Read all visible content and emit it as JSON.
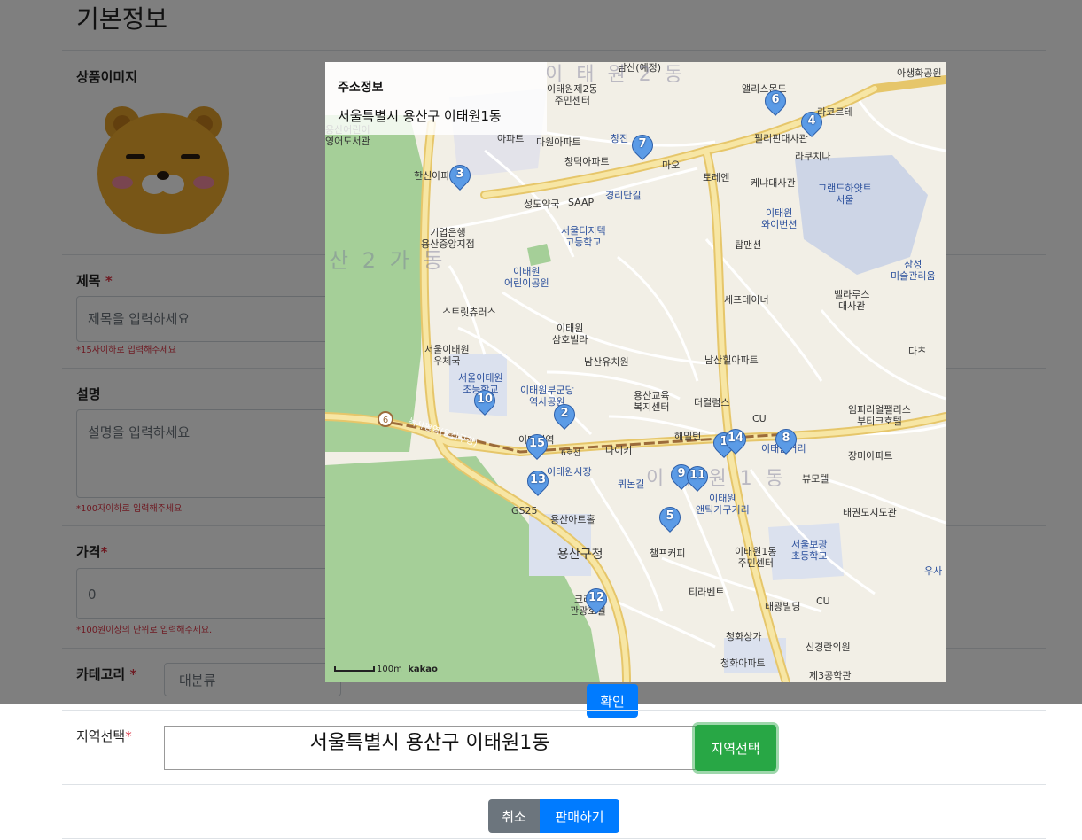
{
  "form": {
    "section_title": "기본정보",
    "image_label": "상품이미지",
    "title_label": "제목",
    "required_mark": "*",
    "title_placeholder": "제목을 입력하세요",
    "title_hint": "*15자이하로 입력해주세요",
    "desc_label": "설명",
    "desc_placeholder": "설명을 입력하세요",
    "desc_hint": "*100자이하로 입력해주세요",
    "price_label": "가격",
    "price_value": "0",
    "price_hint": "*100원이상의 단위로 입력해주세요.",
    "category_label": "카테고리",
    "category_value": "대분류",
    "region_label": "지역선택",
    "region_value": "서울특별시 용산구 이태원1동",
    "region_button": "지역선택",
    "cancel_button": "취소",
    "submit_button": "판매하기"
  },
  "map_modal": {
    "info_title": "주소정보",
    "info_address": "서울특별시 용산구 이태원1동",
    "confirm_button": "확인",
    "scale_label": "100m",
    "provider": "kakao",
    "labels": {
      "l1": "남산(예정)",
      "l2": "이태원제2동\n주민센터",
      "l3": "앨리스몬드",
      "l4": "라코르테",
      "l5": "아생화공원",
      "l6": "용산어린이\n영어도서관",
      "l7": "아파트",
      "l8": "다원아파트",
      "l9": "창진",
      "l10": "필리핀대사관",
      "l11": "창덕아파트",
      "l12": "마오",
      "l13": "토레엔",
      "l14": "라쿠치나",
      "l15": "한신아파트",
      "l16": "케냐대사관",
      "l17": "그랜드하얏트\n서울",
      "l18": "성도약국",
      "l19": "SAAP",
      "l20": "경리단길",
      "l21": "기업은행\n용산중앙지점",
      "l22": "서울디지텍\n고등학교",
      "l23": "이태원\n와이번션",
      "l24": "탑맨션",
      "l25": "산 2 가 동",
      "l26": "이태원\n어린이공원",
      "l27": "삼성\n미술관리움",
      "l28": "세프테이너",
      "l29": "벨라루스\n대사관",
      "l30": "스트릿츄러스",
      "l31": "이태원\n삼호빌라",
      "l32": "서울이태원\n우체국",
      "l33": "남산유치원",
      "l34": "남산힐아파트",
      "l35": "다츠",
      "l36": "서울이태원\n초등학교",
      "l37": "이태원부군당\n역사공원",
      "l38": "용산교육\n복지센터",
      "l39": "더컬럼스",
      "l40": "임피리얼팰리스\n부티크호텔",
      "l41": "CU",
      "l42": "해밀턴",
      "l43": "이태원거리",
      "l44": "장미아파트",
      "l45": "이태원역",
      "l46": "나이키",
      "l47": "6호선",
      "l48": "녹사평역(용산구청)",
      "l49": "이태원시장",
      "l50": "퀴논길",
      "l51": "이 태 원 1 동",
      "l52": "뷰모텔",
      "l53": "이태원\n앤틱가구거리",
      "l54": "GS25",
      "l55": "용산아트홀",
      "l56": "태권도지도관",
      "l57": "용산구청",
      "l58": "챔프커피",
      "l59": "이태원1동\n주민센터",
      "l60": "서울보광\n초등학교",
      "l61": "우사",
      "l62": "티라벤토",
      "l63": "CU",
      "l64": "크라운\n관광호텔",
      "l65": "태광빌딩",
      "l66": "청화상가",
      "l67": "신경란의원",
      "l68": "청화아파트",
      "l69": "제3공학관",
      "l70": "이 태 원 2 동"
    },
    "pins": [
      "6",
      "4",
      "7",
      "3",
      "10",
      "2",
      "1",
      "14",
      "8",
      "15",
      "9",
      "11",
      "13",
      "5",
      "12"
    ]
  }
}
